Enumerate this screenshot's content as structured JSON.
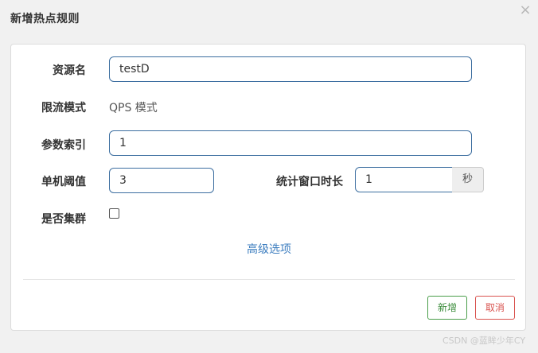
{
  "dialog": {
    "title": "新增热点规则",
    "close_icon": "close-icon"
  },
  "form": {
    "resource_label": "资源名",
    "resource_value": "testD",
    "mode_label": "限流模式",
    "mode_value": "QPS 模式",
    "param_index_label": "参数索引",
    "param_index_value": "1",
    "threshold_label": "单机阈值",
    "threshold_value": "3",
    "window_label": "统计窗口时长",
    "window_value": "1",
    "window_unit": "秒",
    "cluster_label": "是否集群",
    "cluster_checked": false,
    "advanced_link": "高级选项"
  },
  "footer": {
    "add_label": "新增",
    "cancel_label": "取消"
  },
  "watermark": "CSDN @蓝眸少年CY",
  "colors": {
    "accent_border": "#3c6ea0",
    "link": "#3c7dbf",
    "success": "#4a9e4a",
    "danger": "#d9534f"
  }
}
